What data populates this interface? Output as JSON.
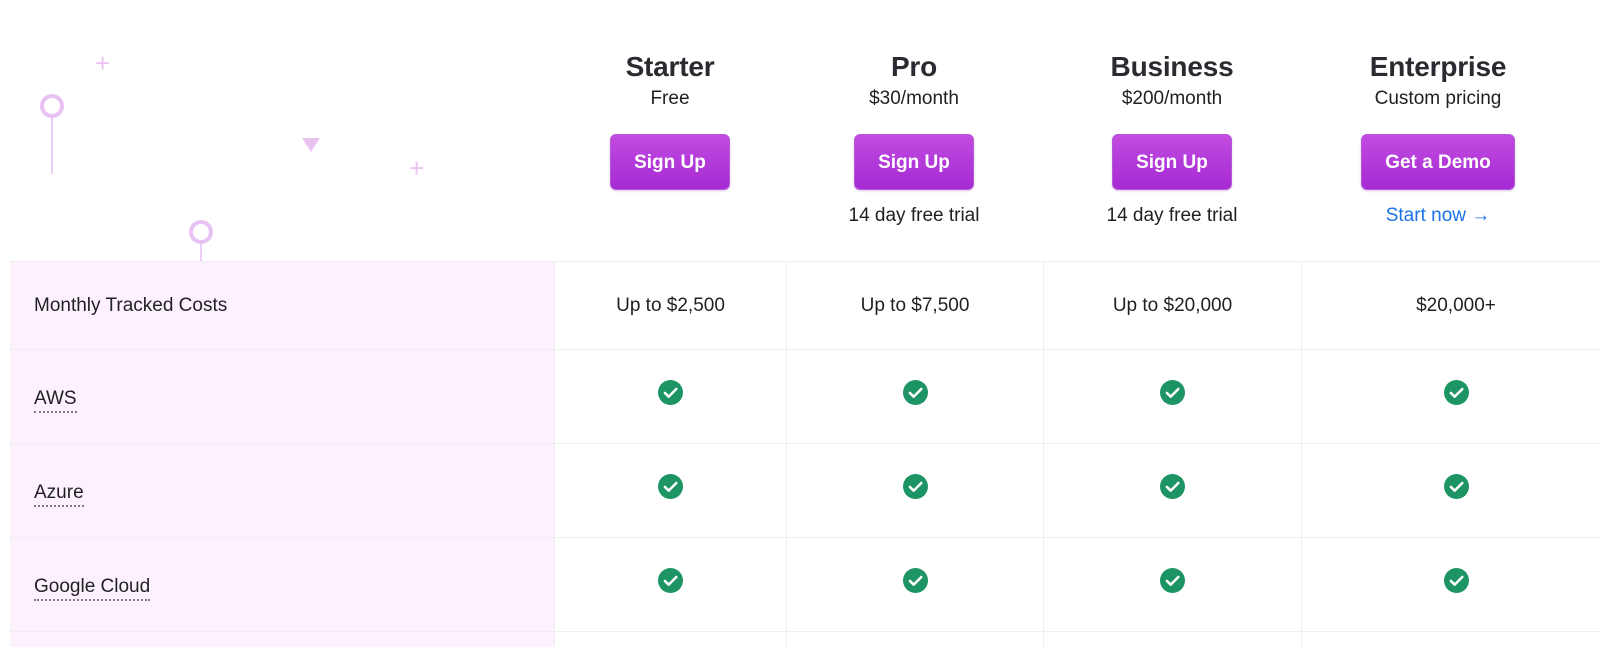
{
  "colors": {
    "accent": "#a52ad3",
    "check": "#1d9464",
    "link": "#1b72e8",
    "label_bg": "#fdf1fd",
    "decor": "#eac3f2"
  },
  "decor": {
    "plus_glyph": "+"
  },
  "plans": [
    {
      "name": "Starter",
      "price": "Free",
      "button": "Sign Up",
      "note": ""
    },
    {
      "name": "Pro",
      "price": "$30/month",
      "button": "Sign Up",
      "note": "14 day free trial"
    },
    {
      "name": "Business",
      "price": "$200/month",
      "button": "Sign Up",
      "note": "14 day free trial"
    },
    {
      "name": "Enterprise",
      "price": "Custom pricing",
      "button": "Get a Demo",
      "link": "Start now →"
    }
  ],
  "table": {
    "rows": [
      {
        "label": "Monthly Tracked Costs",
        "values": [
          "Up to $2,500",
          "Up to $7,500",
          "Up to $20,000",
          "$20,000+"
        ]
      },
      {
        "label": "AWS",
        "icon": "check-circle-icon",
        "included": [
          true,
          true,
          true,
          true
        ]
      },
      {
        "label": "Azure",
        "icon": "check-circle-icon",
        "included": [
          true,
          true,
          true,
          true
        ]
      },
      {
        "label": "Google Cloud",
        "icon": "check-circle-icon",
        "included": [
          true,
          true,
          true,
          true
        ]
      }
    ]
  }
}
